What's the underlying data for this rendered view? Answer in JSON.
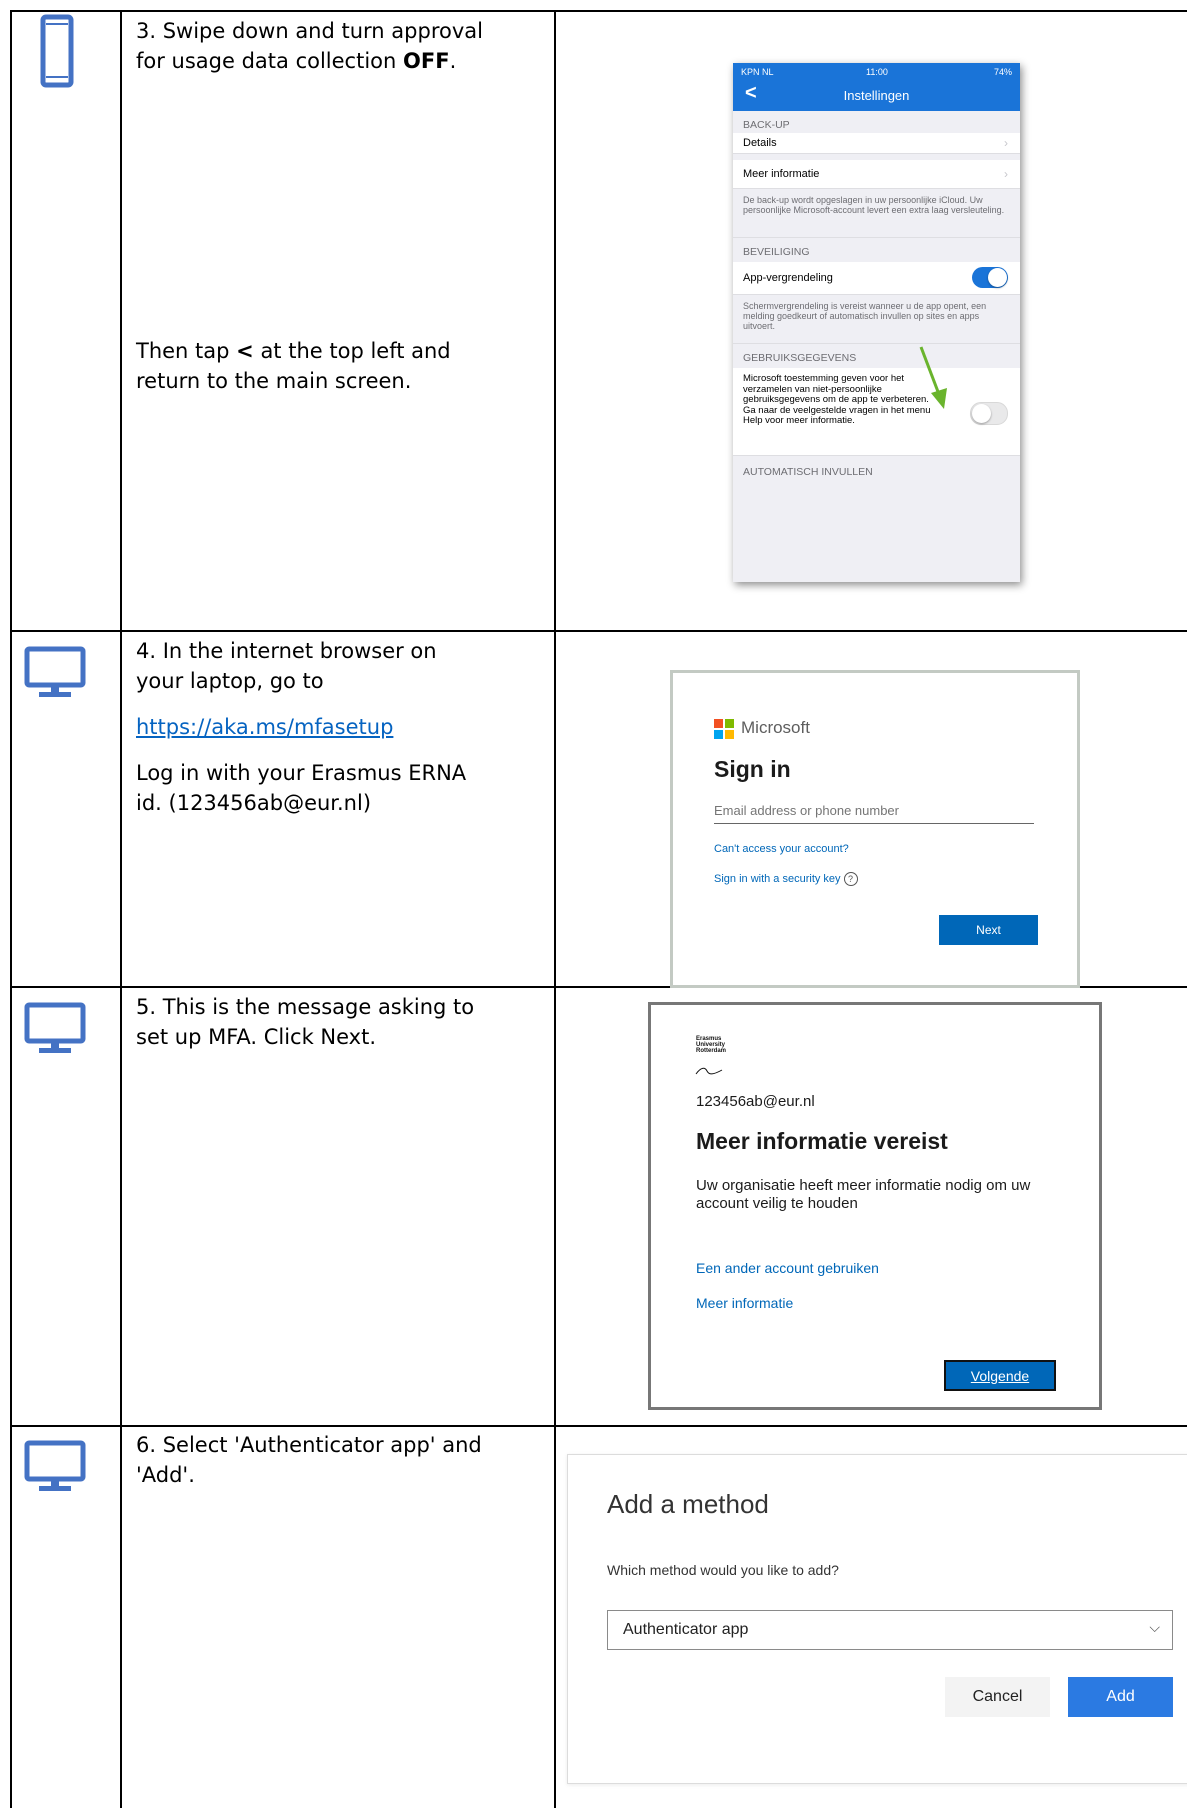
{
  "steps": [
    {
      "icon": "smartphone-icon",
      "text": {
        "line1": "3. Swipe down and turn approval",
        "line2_prefix": "for usage data collection ",
        "line2_bold": "OFF",
        "line2_suffix": ".",
        "then_line1_prefix": "Then tap ",
        "then_bold": "<",
        "then_line1_suffix": " at the top left and",
        "then_line2": "return to the main screen."
      },
      "screenshot": {
        "status_carrier": "KPN NL",
        "status_time": "11:00",
        "status_battery": "74%",
        "back_glyph": "<",
        "title": "Instellingen",
        "section_backup": "BACK-UP",
        "row_details": "Details",
        "row_more_info": "Meer informatie",
        "backup_note": "De back-up wordt opgeslagen in uw persoonlijke iCloud. Uw persoonlijke Microsoft-account levert een extra laag versleuteling.",
        "section_security": "BEVEILIGING",
        "row_app_lock": "App-vergrendeling",
        "app_lock_on": true,
        "security_note": "Schermvergrendeling is vereist wanneer u de app opent, een melding goedkeurt of automatisch invullen op sites en apps uitvoert.",
        "section_usage": "GEBRUIKSGEGEVENS",
        "usage_text": "Microsoft toestemming geven voor het verzamelen van niet-persoonlijke gebruiksgegevens om de app te verbeteren. Ga naar de veelgestelde vragen in het menu Help voor meer informatie.",
        "usage_on": false,
        "section_autofill": "AUTOMATISCH INVULLEN",
        "accent_color": "#1a74d8",
        "arrow_color": "#6ab42d"
      }
    },
    {
      "icon": "monitor-icon",
      "text": {
        "line1": "4. In the internet browser on",
        "line2": "your laptop, go to",
        "link": "https://aka.ms/mfasetup",
        "line3": "Log in with your Erasmus ERNA",
        "line4": "id. (123456ab@eur.nl)"
      },
      "screenshot": {
        "brand": "Microsoft",
        "heading": "Sign in",
        "email_placeholder": "Email address or phone number",
        "link_cant_access": "Can't access your account?",
        "link_security_key": "Sign in with a security key",
        "help_glyph": "?",
        "next_button": "Next",
        "accent_color": "#0067b8"
      }
    },
    {
      "icon": "monitor-icon",
      "text": {
        "line1": "5. This is the message asking to",
        "line2": "set up MFA. Click Next."
      },
      "screenshot": {
        "logo_line1": "Erasmus",
        "logo_line2": "University",
        "logo_line3": "Rotterdam",
        "email": "123456ab@eur.nl",
        "heading": "Meer informatie vereist",
        "body": "Uw organisatie heeft meer informatie nodig om uw account veilig te houden",
        "link_other_account": "Een ander account gebruiken",
        "link_more_info": "Meer informatie",
        "next_button": "Volgende"
      }
    },
    {
      "icon": "monitor-icon",
      "text": {
        "line1": "6. Select 'Authenticator app' and",
        "line2": "'Add'."
      },
      "screenshot": {
        "heading": "Add a method",
        "question": "Which method would you like to add?",
        "selected": "Authenticator app",
        "cancel_button": "Cancel",
        "add_button": "Add",
        "accent_color": "#2b7ae2"
      }
    }
  ],
  "icon_color": "#4472c4"
}
